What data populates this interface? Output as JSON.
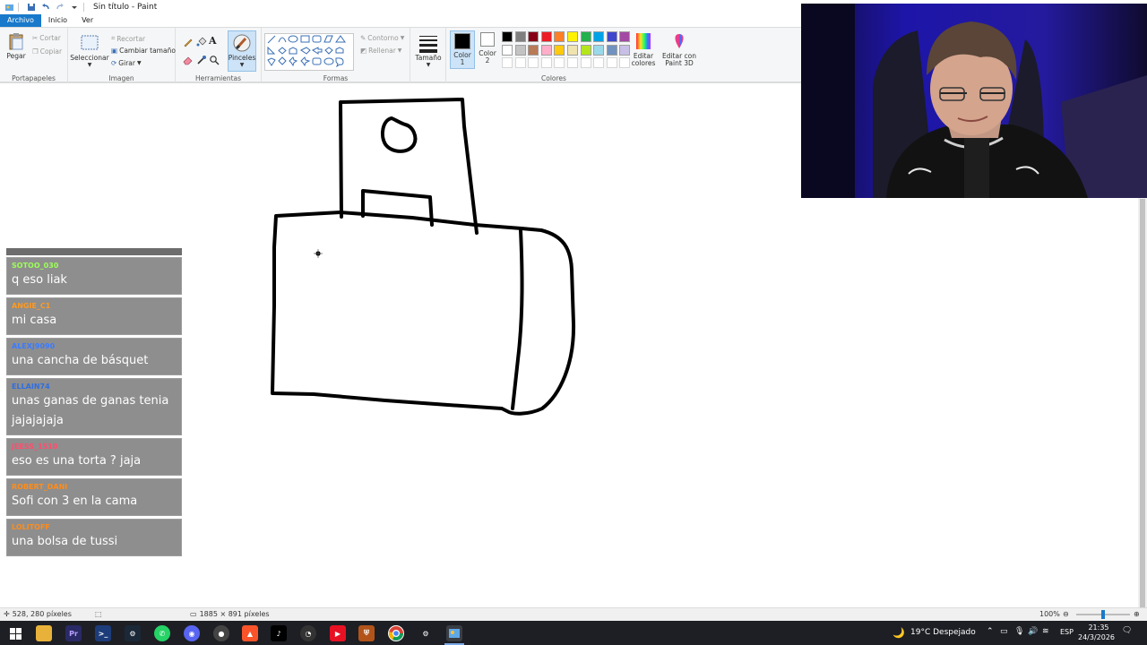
{
  "window": {
    "title": "Sin título - Paint"
  },
  "tabs": [
    "Archivo",
    "Inicio",
    "Ver"
  ],
  "ribbon": {
    "clipboard": {
      "paste": "Pegar",
      "cut": "Cortar",
      "copy": "Copiar",
      "label": "Portapapeles"
    },
    "image": {
      "select": "Seleccionar",
      "crop": "Recortar",
      "resize": "Cambiar tamaño",
      "rotate": "Girar",
      "label": "Imagen"
    },
    "tools": {
      "brushes": "Pinceles",
      "label": "Herramientas"
    },
    "shapes": {
      "outline": "Contorno",
      "fill": "Rellenar",
      "label": "Formas"
    },
    "size": {
      "label": "Tamaño"
    },
    "colors": {
      "color1": "Color 1",
      "color2": "Color 2",
      "edit_colors": "Editar colores",
      "edit_paint3d": "Editar con Paint 3D",
      "label": "Colores",
      "color1_value": "#000000",
      "color2_value": "#ffffff",
      "palette_row1": [
        "#000000",
        "#7f7f7f",
        "#880015",
        "#ed1c24",
        "#ff7f27",
        "#fff200",
        "#22b14c",
        "#00a2e8",
        "#3f48cc",
        "#a349a4"
      ],
      "palette_row2": [
        "#ffffff",
        "#c3c3c3",
        "#b97a57",
        "#ffaec9",
        "#ffc90e",
        "#efe4b0",
        "#b5e61d",
        "#99d9ea",
        "#7092be",
        "#c8bfe7"
      ]
    }
  },
  "chat": {
    "messages": [
      {
        "user": "SOTOO_030",
        "text": "q eso liak",
        "color": "#9cff57"
      },
      {
        "user": "ANGIE_C1",
        "text": "mi casa",
        "color": "#ff9a1f"
      },
      {
        "user": "ALEXJ9090",
        "text": "una cancha de básquet",
        "color": "#3a7bff"
      },
      {
        "user": "ELLAIN74",
        "text": "unas ganas de ganas tenia jajajajaja",
        "color": "#2f6ee0"
      },
      {
        "user": "JEESS_1510",
        "text": "eso es una torta ? jaja",
        "color": "#ff4d6d"
      },
      {
        "user": "ROBERT_DANI",
        "text": "Sofi con 3 en la cama",
        "color": "#ff8c1a"
      },
      {
        "user": "LOLITOFF",
        "text": "una bolsa de tussi",
        "color": "#ff8c1a"
      }
    ]
  },
  "statusbar": {
    "cursor_pos": "528, 280 píxeles",
    "canvas_size": "1885 × 891 píxeles",
    "zoom": "100%",
    "zoom_fraction": 0.5
  },
  "taskbar": {
    "weather": "19°C  Despejado",
    "lang": "ESP",
    "time": "21:35",
    "date": "24/3/2026"
  }
}
